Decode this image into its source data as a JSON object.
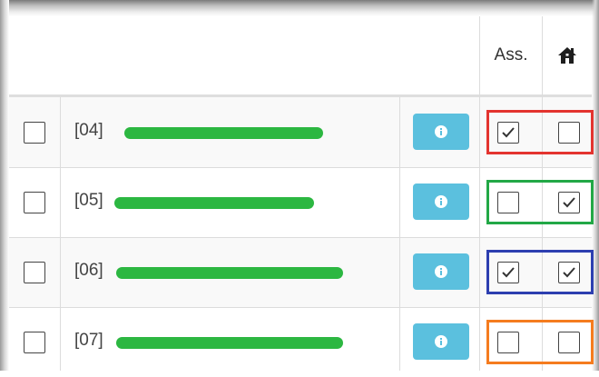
{
  "table": {
    "columns": {
      "assigned_label": "Ass.",
      "home_icon": "home-icon"
    },
    "rows": [
      {
        "id_label": "[04]",
        "name_redacted": true,
        "assigned": true,
        "home": false,
        "highlight_color": "#e3342f"
      },
      {
        "id_label": "[05]",
        "name_redacted": true,
        "assigned": false,
        "home": true,
        "highlight_color": "#22a846"
      },
      {
        "id_label": "[06]",
        "name_redacted": true,
        "assigned": true,
        "home": true,
        "highlight_color": "#2d3fb0"
      },
      {
        "id_label": "[07]",
        "name_redacted": true,
        "assigned": false,
        "home": false,
        "highlight_color": "#f57c1f"
      }
    ]
  },
  "colors": {
    "info_button": "#5bc0de",
    "redaction_marker": "#2cb741"
  }
}
